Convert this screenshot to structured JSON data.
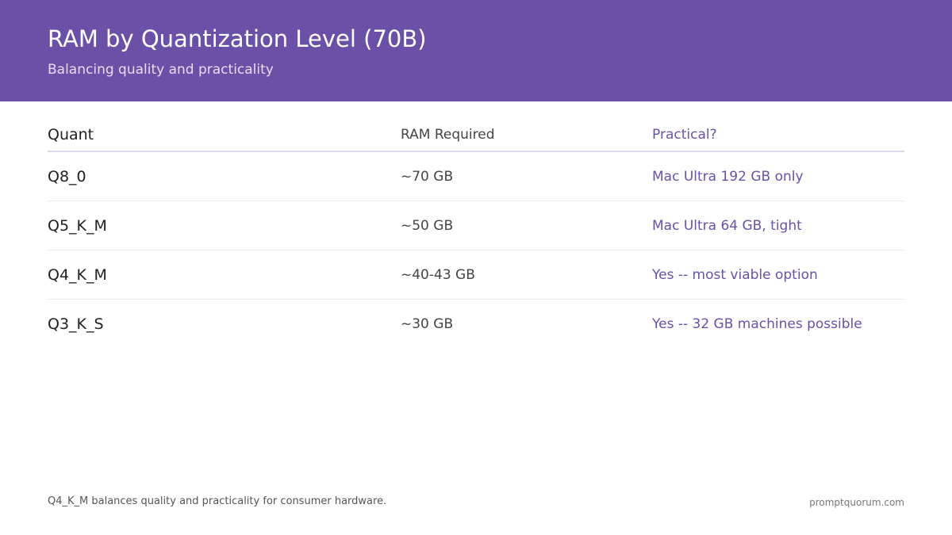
{
  "header": {
    "title": "RAM by Quantization Level (70B)",
    "subtitle": "Balancing quality and practicality"
  },
  "table": {
    "columns": [
      "Quant",
      "RAM Required",
      "Practical?"
    ],
    "rows": [
      {
        "quant": "Q8_0",
        "ram": "~70 GB",
        "practical": "Mac Ultra 192 GB only"
      },
      {
        "quant": "Q5_K_M",
        "ram": "~50 GB",
        "practical": "Mac Ultra 64 GB, tight"
      },
      {
        "quant": "Q4_K_M",
        "ram": "~40-43 GB",
        "practical": "Yes -- most viable option"
      },
      {
        "quant": "Q3_K_S",
        "ram": "~30 GB",
        "practical": "Yes -- 32 GB machines possible"
      }
    ]
  },
  "footer": {
    "note": "Q4_K_M balances quality and practicality for consumer hardware.",
    "brand": "promptquorum.com"
  },
  "colors": {
    "header_bg": "#6a50a7",
    "accent": "#6a50a7"
  }
}
